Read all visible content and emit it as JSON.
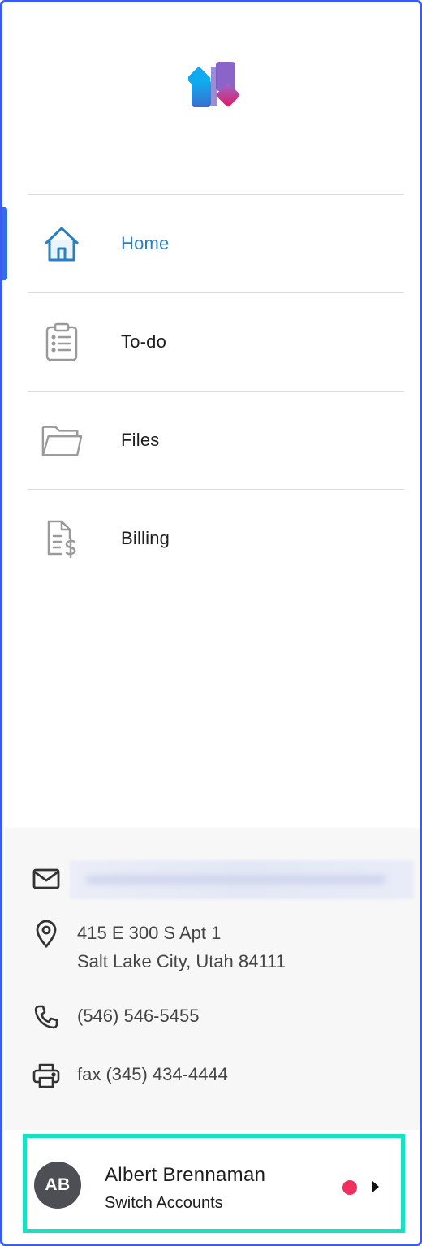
{
  "brand": {
    "logo": "app-logo",
    "colors": {
      "cyan": "#0ba5ec",
      "blue": "#3a6fd0",
      "purple": "#8e5fc0",
      "magenta": "#d81b6a"
    }
  },
  "nav": {
    "items": [
      {
        "label": "Home",
        "icon": "home-icon",
        "active": true
      },
      {
        "label": "To-do",
        "icon": "clipboard-icon",
        "active": false
      },
      {
        "label": "Files",
        "icon": "folder-icon",
        "active": false
      },
      {
        "label": "Billing",
        "icon": "billing-icon",
        "active": false
      }
    ],
    "active_color": "#2a7fc1"
  },
  "contact": {
    "address_line1": "415 E 300 S Apt 1",
    "address_line2": "Salt Lake City, Utah 84111",
    "phone": "(546) 546-5455",
    "fax": "fax (345) 434-4444"
  },
  "account": {
    "initials": "AB",
    "name": "Albert Brennaman",
    "subtitle": "Switch Accounts",
    "status_color": "#f2305e",
    "highlight_color": "#19e0c0"
  }
}
